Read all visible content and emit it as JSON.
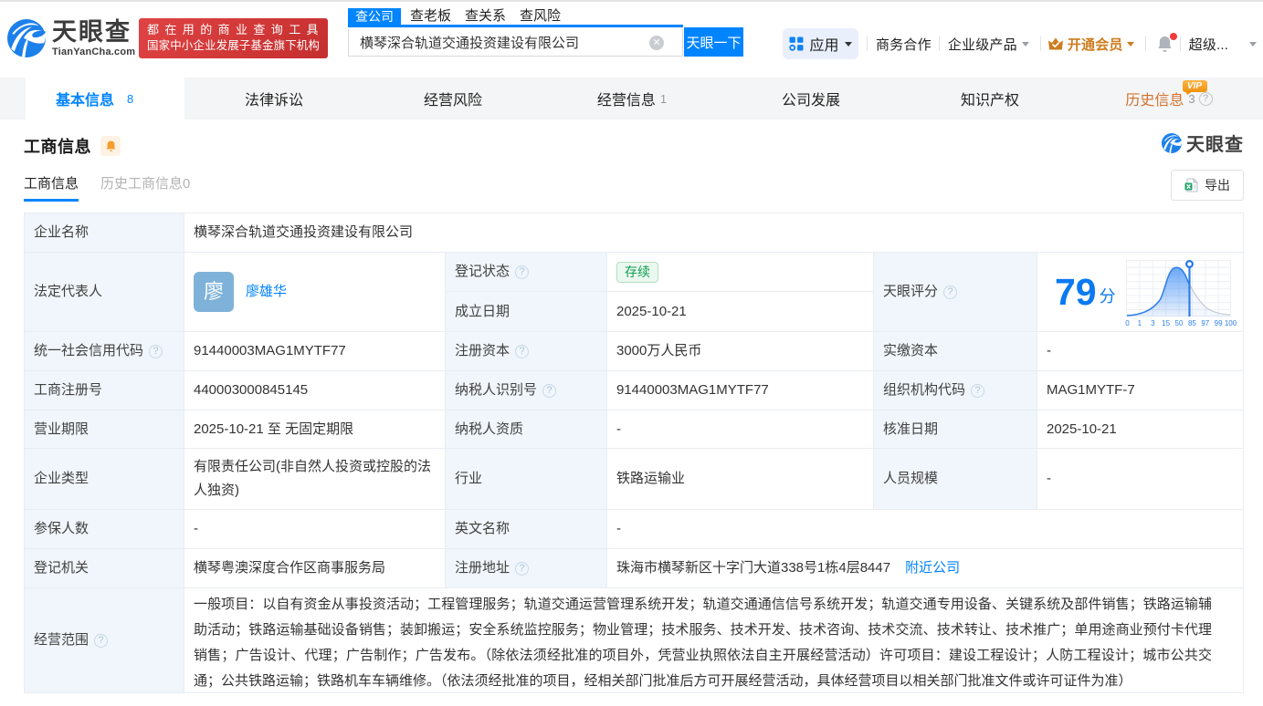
{
  "brand": {
    "logo_cn": "天眼查",
    "logo_en": "TianYanCha.com",
    "slogan_line1": "都在用的商业查询工具",
    "slogan_line2": "国家中小企业发展子基金旗下机构",
    "accent_blue": "#0084ff"
  },
  "search": {
    "tabs": [
      "查公司",
      "查老板",
      "查关系",
      "查风险"
    ],
    "active_tab": "查公司",
    "value": "横琴深合轨道交通投资建设有限公司",
    "button": "天眼一下"
  },
  "header_menu": {
    "apps": "应用",
    "business_coop": "商务合作",
    "enterprise_products": "企业级产品",
    "open_vip": "开通会员",
    "user": "超级..."
  },
  "main_tabs": {
    "t0": {
      "label": "基本信息",
      "count": "8"
    },
    "t1": {
      "label": "法律诉讼"
    },
    "t2": {
      "label": "经营风险"
    },
    "t3": {
      "label": "经营信息",
      "count": "1"
    },
    "t4": {
      "label": "公司发展"
    },
    "t5": {
      "label": "知识产权"
    },
    "t6": {
      "label": "历史信息",
      "count": "3",
      "vip": "VIP"
    }
  },
  "section": {
    "title": "工商信息",
    "watermark": "天眼查",
    "subtab_active": "工商信息",
    "subtab_history": "历史工商信息0",
    "export": "导出"
  },
  "table": {
    "company_name": {
      "label": "企业名称",
      "value": "横琴深合轨道交通投资建设有限公司"
    },
    "legal_rep": {
      "label": "法定代表人",
      "avatar": "廖",
      "name": "廖雄华"
    },
    "reg_status": {
      "label": "登记状态",
      "value": "存续"
    },
    "establish_date": {
      "label": "成立日期",
      "value": "2025-10-21"
    },
    "score": {
      "label": "天眼评分",
      "value": "79",
      "unit": "分"
    },
    "credit_code": {
      "label": "统一社会信用代码",
      "value": "91440003MAG1MYTF77"
    },
    "reg_capital": {
      "label": "注册资本",
      "value": "3000万人民币"
    },
    "paid_capital": {
      "label": "实缴资本",
      "value": "-"
    },
    "reg_number": {
      "label": "工商注册号",
      "value": "440003000845145"
    },
    "taxpayer_id": {
      "label": "纳税人识别号",
      "value": "91440003MAG1MYTF77"
    },
    "org_code": {
      "label": "组织机构代码",
      "value": "MAG1MYTF-7"
    },
    "business_term": {
      "label": "营业期限",
      "value": "2025-10-21 至 无固定期限"
    },
    "taxpayer_quality": {
      "label": "纳税人资质",
      "value": "-"
    },
    "approval_date": {
      "label": "核准日期",
      "value": "2025-10-21"
    },
    "company_type": {
      "label": "企业类型",
      "value": "有限责任公司(非自然人投资或控股的法人独资)"
    },
    "industry": {
      "label": "行业",
      "value": "铁路运输业"
    },
    "staff_size": {
      "label": "人员规模",
      "value": "-"
    },
    "insured_count": {
      "label": "参保人数",
      "value": "-"
    },
    "english_name": {
      "label": "英文名称",
      "value": "-"
    },
    "reg_authority": {
      "label": "登记机关",
      "value": "横琴粤澳深度合作区商事服务局"
    },
    "reg_address": {
      "label": "注册地址",
      "value": "珠海市横琴新区十字门大道338号1栋4层8447",
      "link": "附近公司"
    },
    "business_scope": {
      "label": "经营范围",
      "value": "一般项目：以自有资金从事投资活动；工程管理服务；轨道交通运营管理系统开发；轨道交通通信信号系统开发；轨道交通专用设备、关键系统及部件销售；铁路运输辅助活动；铁路运输基础设备销售；装卸搬运；安全系统监控服务；物业管理；技术服务、技术开发、技术咨询、技术交流、技术转让、技术推广；单用途商业预付卡代理销售；广告设计、代理；广告制作；广告发布。（除依法须经批准的项目外，凭营业执照依法自主开展经营活动）许可项目：建设工程设计；人防工程设计；城市公共交通；公共铁路运输；铁路机车车辆维修。（依法须经批准的项目，经相关部门批准后方可开展经营活动，具体经营项目以相关部门批准文件或许可证件为准）"
    }
  },
  "chart_data": {
    "type": "area",
    "title": "天眼评分",
    "score": 79,
    "x_ticks": [
      "0",
      "1",
      "3",
      "15",
      "50",
      "85",
      "97",
      "99",
      "100"
    ],
    "marker_value": 79,
    "curve": "skewed-bell"
  }
}
